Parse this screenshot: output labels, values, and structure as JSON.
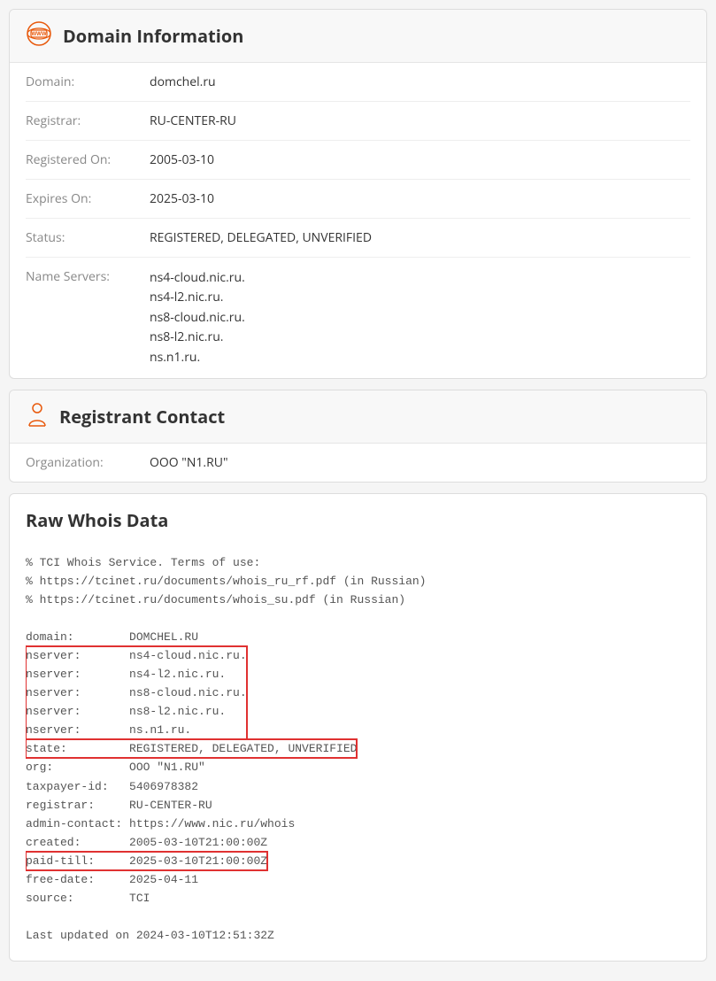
{
  "domainInfo": {
    "title": "Domain Information",
    "rows": {
      "domainLabel": "Domain:",
      "domainValue": "domchel.ru",
      "registrarLabel": "Registrar:",
      "registrarValue": "RU-CENTER-RU",
      "registeredOnLabel": "Registered On:",
      "registeredOnValue": "2005-03-10",
      "expiresOnLabel": "Expires On:",
      "expiresOnValue": "2025-03-10",
      "statusLabel": "Status:",
      "statusValue": "REGISTERED, DELEGATED, UNVERIFIED",
      "nameServersLabel": "Name Servers:",
      "ns1": "ns4-cloud.nic.ru.",
      "ns2": "ns4-l2.nic.ru.",
      "ns3": "ns8-cloud.nic.ru.",
      "ns4": "ns8-l2.nic.ru.",
      "ns5": "ns.n1.ru."
    }
  },
  "registrant": {
    "title": "Registrant Contact",
    "orgLabel": "Organization:",
    "orgValue": "OOO \"N1.RU\""
  },
  "raw": {
    "title": "Raw Whois Data",
    "l1": "% TCI Whois Service. Terms of use:",
    "l2": "% https://tcinet.ru/documents/whois_ru_rf.pdf (in Russian)",
    "l3": "% https://tcinet.ru/documents/whois_su.pdf (in Russian)",
    "l4": "",
    "l5": "domain:        DOMCHEL.RU",
    "l6": "nserver:       ns4-cloud.nic.ru.",
    "l7": "nserver:       ns4-l2.nic.ru.",
    "l8": "nserver:       ns8-cloud.nic.ru.",
    "l9": "nserver:       ns8-l2.nic.ru.",
    "l10": "nserver:       ns.n1.ru.",
    "l11": "state:         REGISTERED, DELEGATED, UNVERIFIED",
    "l12": "org:           OOO \"N1.RU\"",
    "l13": "taxpayer-id:   5406978382",
    "l14": "registrar:     RU-CENTER-RU",
    "l15": "admin-contact: https://www.nic.ru/whois",
    "l16": "created:       2005-03-10T21:00:00Z",
    "l17": "paid-till:     2025-03-10T21:00:00Z",
    "l18": "free-date:     2025-04-11",
    "l19": "source:        TCI",
    "l20": "",
    "l21": "Last updated on 2024-03-10T12:51:32Z"
  }
}
